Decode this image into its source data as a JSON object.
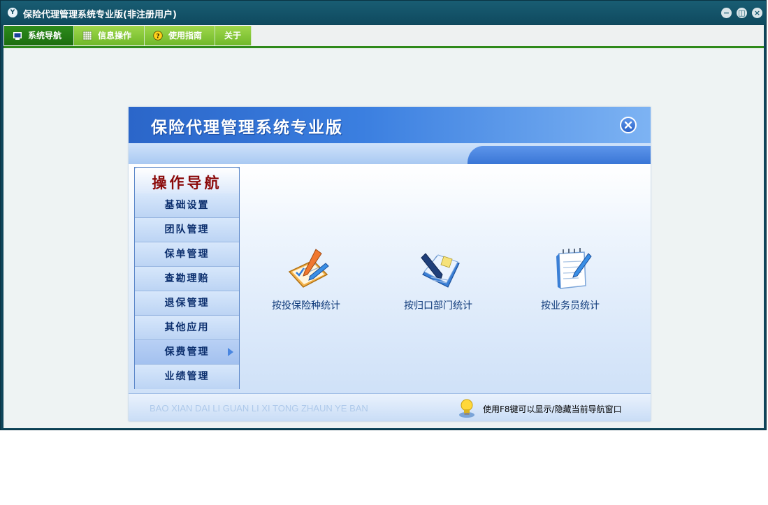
{
  "window": {
    "title": "保险代理管理系统专业版(非注册用户)",
    "logo_text": "Y"
  },
  "menubar": {
    "tabs": [
      {
        "label": "系统导航",
        "active": true
      },
      {
        "label": "信息操作",
        "active": false
      },
      {
        "label": "使用指南",
        "active": false
      },
      {
        "label": "关于",
        "active": false
      }
    ]
  },
  "panel": {
    "title": "保险代理管理系统专业版",
    "footer_pinyin": "BAO XIAN DAI LI GUAN LI XI TONG ZHAUN YE BAN",
    "footer_hint": "使用F8键可以显示/隐藏当前导航窗口"
  },
  "op_nav": {
    "title": "操作导航",
    "items": [
      {
        "label": "基础设置"
      },
      {
        "label": "团队管理"
      },
      {
        "label": "保单管理"
      },
      {
        "label": "查勘理赔"
      },
      {
        "label": "退保管理"
      },
      {
        "label": "其他应用"
      },
      {
        "label": "保费管理",
        "selected": true
      },
      {
        "label": "业绩管理"
      }
    ]
  },
  "functions": [
    {
      "label": "按投保险种统计",
      "icon": "checklist-pencil-icon"
    },
    {
      "label": "按归口部门统计",
      "icon": "document-pen-icon"
    },
    {
      "label": "按业务员统计",
      "icon": "notepad-pen-icon"
    }
  ],
  "colors": {
    "title_bar": "#0f4a5f",
    "menu_active": "#2d8c1c",
    "menu_normal": "#8cc63f",
    "panel_header": "#3b7fe0",
    "nav_title": "#8b0a0a",
    "nav_text": "#0c2f6e"
  }
}
